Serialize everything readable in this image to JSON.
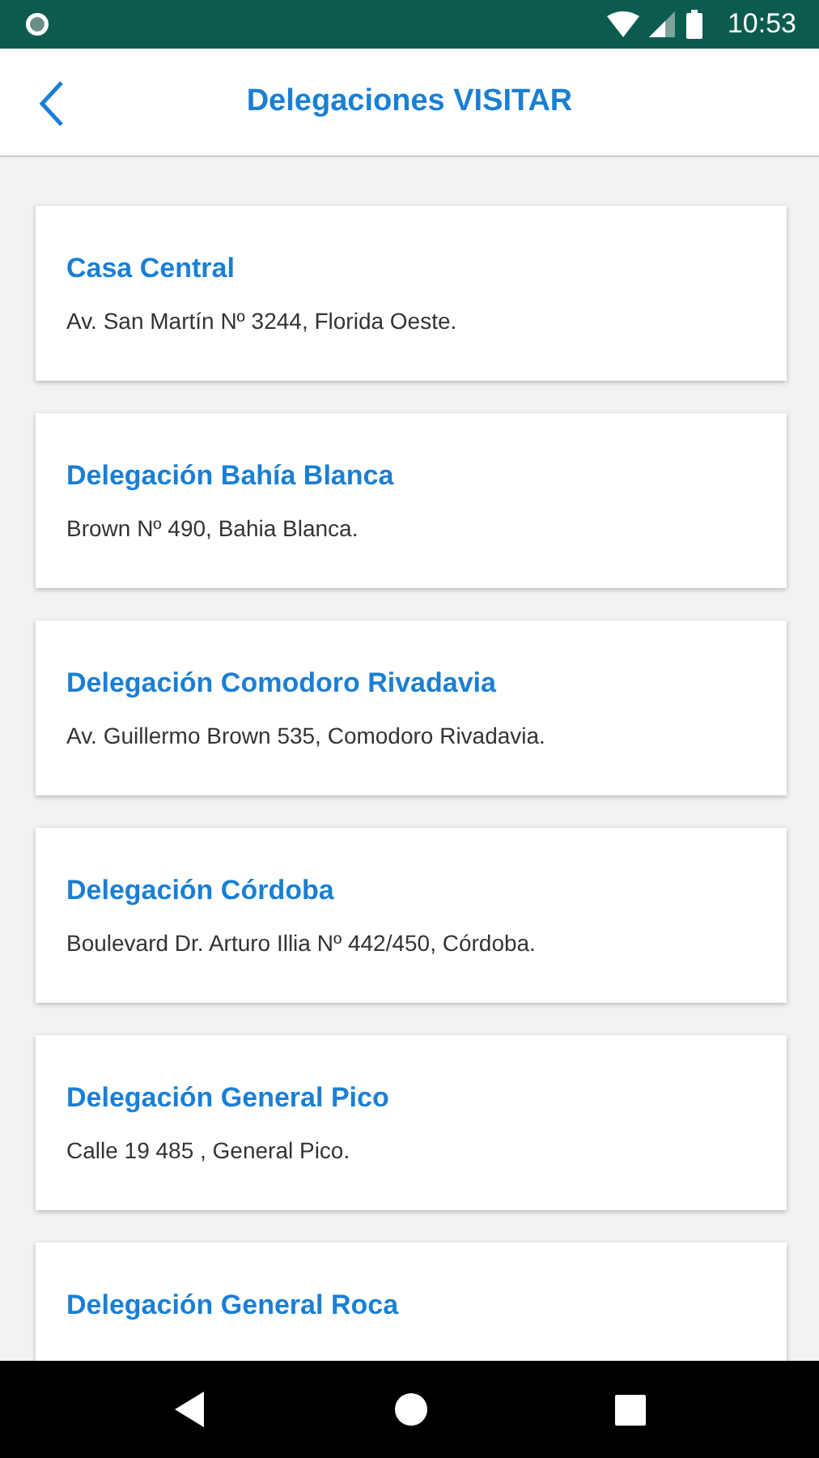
{
  "status_bar": {
    "time": "10:53"
  },
  "header": {
    "title": "Delegaciones VISITAR"
  },
  "delegations": [
    {
      "name": "Casa Central",
      "address": "Av. San Martín Nº 3244, Florida Oeste."
    },
    {
      "name": "Delegación Bahía Blanca",
      "address": "Brown Nº 490, Bahia Blanca."
    },
    {
      "name": "Delegación Comodoro Rivadavia",
      "address": "Av. Guillermo Brown 535, Comodoro Rivadavia."
    },
    {
      "name": "Delegación Córdoba",
      "address": "Boulevard Dr. Arturo Illia Nº 442/450, Córdoba."
    },
    {
      "name": "Delegación General Pico",
      "address": "Calle 19 485 , General Pico."
    },
    {
      "name": "Delegación General Roca"
    }
  ]
}
